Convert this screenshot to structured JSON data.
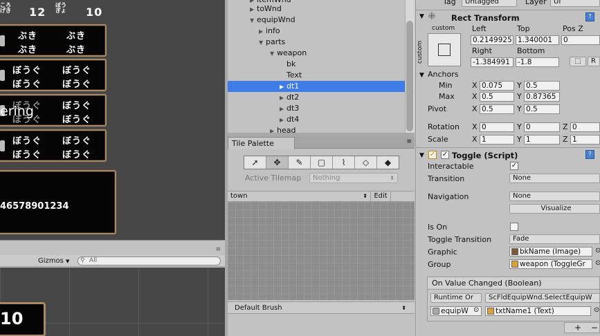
{
  "game": {
    "row0_small_a": "ころ\nげき",
    "row0_num_a": "12",
    "row0_small_b": "ぼう\nぎょ",
    "row0_num_b": "10",
    "rows": [
      {
        "a1": "ぶき",
        "a2": "ぶき",
        "b1": "ぶき",
        "b2": "ぶき"
      },
      {
        "a1": "ぼうぐ",
        "a2": "ぼうぐ",
        "b1": "ぼうぐ",
        "b2": "ぼうぐ"
      },
      {
        "a1": "ぼうぐ",
        "a2": "ぼうぐ",
        "b1": "ぼうぐ",
        "b2": "ぼうぐ"
      },
      {
        "a1": "ぼうぐ",
        "a2": "ぼうぐ",
        "b1": "ぼうぐ",
        "b2": "ぼうぐ"
      }
    ],
    "overlay_text": "ering",
    "digits": "46578901234"
  },
  "scene": {
    "gizmos": "Gizmos",
    "search_placeholder": "All",
    "number": "10"
  },
  "hierarchy": {
    "items": [
      {
        "label": "itemWnd",
        "arrow": "▶"
      },
      {
        "label": "toWnd",
        "arrow": "▶"
      },
      {
        "label": "equipWnd",
        "arrow": "▼"
      },
      {
        "label": "info",
        "arrow": "▶"
      },
      {
        "label": "parts",
        "arrow": "▼"
      },
      {
        "label": "weapon",
        "arrow": "▼"
      },
      {
        "label": "bk",
        "arrow": ""
      },
      {
        "label": "Text",
        "arrow": ""
      },
      {
        "label": "dt1",
        "arrow": "▶"
      },
      {
        "label": "dt2",
        "arrow": "▶"
      },
      {
        "label": "dt3",
        "arrow": "▶"
      },
      {
        "label": "dt4",
        "arrow": "▶"
      },
      {
        "label": "head",
        "arrow": "▶"
      }
    ]
  },
  "tile_palette": {
    "tab": "Tile Palette",
    "active_tilemap_label": "Active Tilemap",
    "active_tilemap_value": "Nothing",
    "palette": "town",
    "edit": "Edit",
    "brush": "Default Brush"
  },
  "inspector": {
    "tag_label": "Tag",
    "tag_value": "Untagged",
    "layer_label": "Layer",
    "layer_value": "UI",
    "rect_title": "Rect Transform",
    "custom": "custom",
    "left_label": "Left",
    "top_label": "Top",
    "posz_label": "Pos Z",
    "left_value": "0.2149925",
    "top_value": "1.340001",
    "posz_value": "0",
    "right_label": "Right",
    "bottom_label": "Bottom",
    "right_value": "-1.384991",
    "bottom_value": "-1.8",
    "r_btn": "R",
    "anchors": "Anchors",
    "min": "Min",
    "max": "Max",
    "x": "X",
    "y": "Y",
    "z": "Z",
    "min_x": "0.075",
    "min_y": "0.5",
    "max_x": "0.5",
    "max_y": "0.87365",
    "pivot": "Pivot",
    "pivot_x": "0.5",
    "pivot_y": "0.5",
    "rotation": "Rotation",
    "rot_x": "0",
    "rot_y": "0",
    "rot_z": "0",
    "scale": "Scale",
    "scale_x": "1",
    "scale_y": "1",
    "scale_z": "1",
    "toggle_title": "Toggle (Script)",
    "interactable": "Interactable",
    "transition": "Transition",
    "transition_value": "None",
    "navigation": "Navigation",
    "navigation_value": "None",
    "visualize": "Visualize",
    "is_on": "Is On",
    "toggle_transition": "Toggle Transition",
    "toggle_transition_value": "Fade",
    "graphic": "Graphic",
    "graphic_value": "bkName (Image)",
    "group": "Group",
    "group_value": "weapon (ToggleGr",
    "on_value_changed": "On Value Changed (Boolean)",
    "runtime": "Runtime Or",
    "function": "ScFldEquipWnd.SelectEquipW",
    "target_obj": "equipW",
    "arg_obj": "txtName1 (Text)",
    "plus": "+",
    "minus": "−"
  }
}
